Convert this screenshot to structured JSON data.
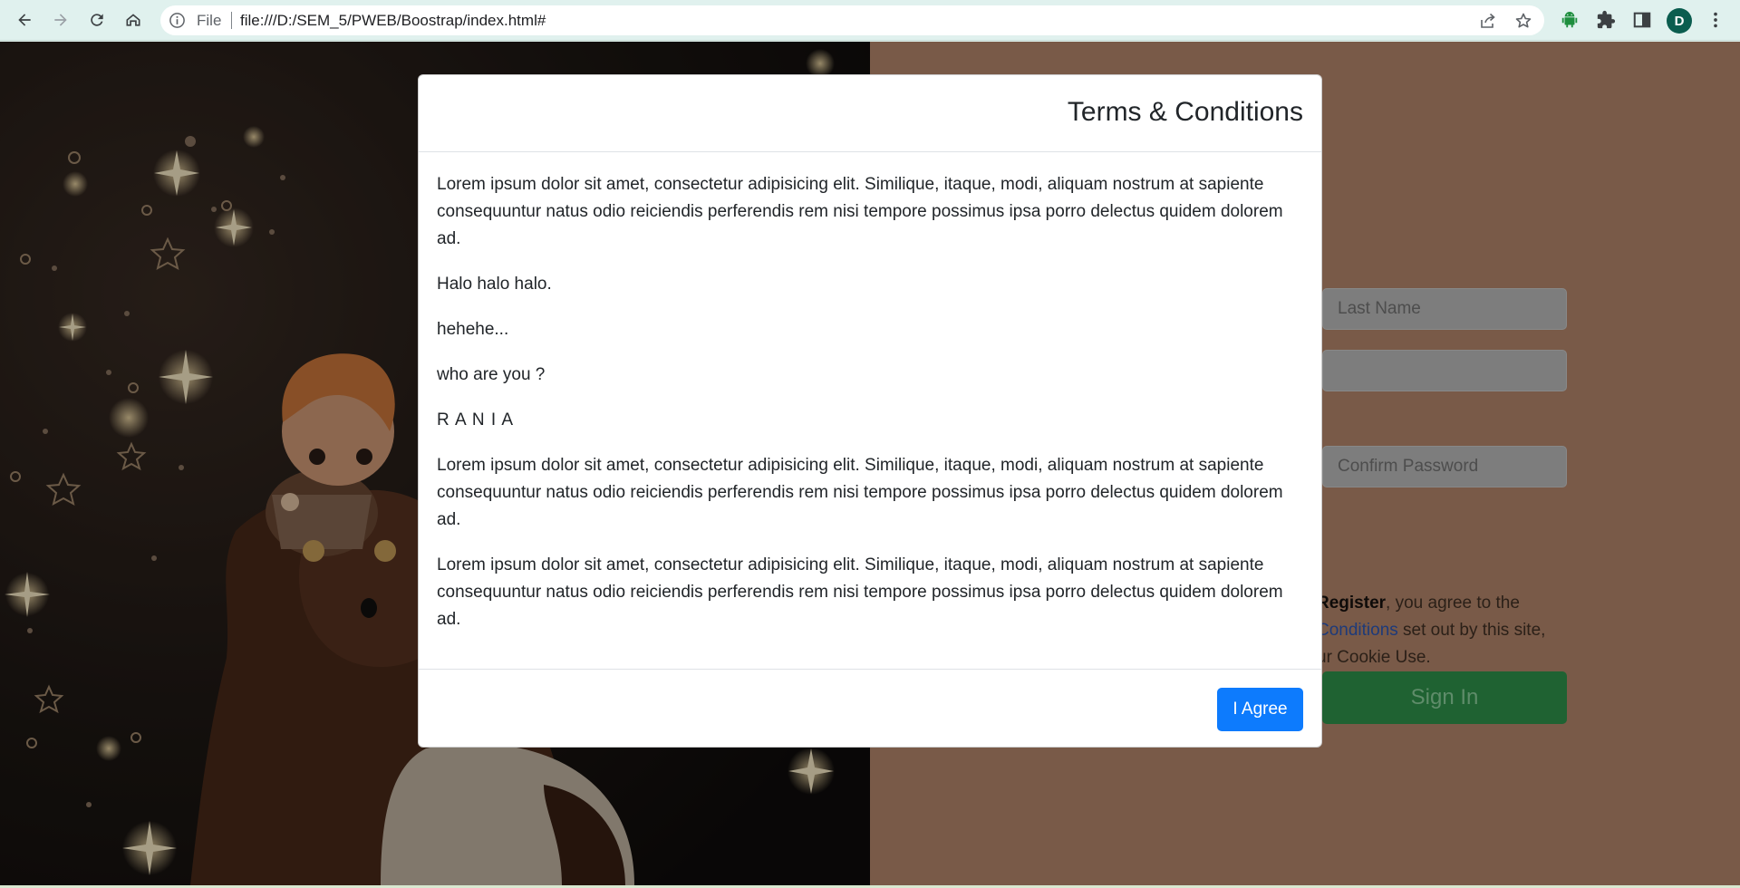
{
  "browser": {
    "scheme_label": "File",
    "url": "file:///D:/SEM_5/PWEB/Boostrap/index.html#",
    "profile_initial": "D"
  },
  "background_form": {
    "last_name_placeholder": "Last Name",
    "confirm_password_placeholder": "Confirm Password",
    "terms_line1_bold": "Register",
    "terms_line1_rest": ", you agree to the",
    "terms_line2_link": "Conditions",
    "terms_line2_rest": " set out by this site,",
    "terms_line3": "ur Cookie Use.",
    "sign_in_label": "Sign In"
  },
  "modal": {
    "title": "Terms & Conditions",
    "paragraphs": [
      "Lorem ipsum dolor sit amet, consectetur adipisicing elit. Similique, itaque, modi, aliquam nostrum at sapiente consequuntur natus odio reiciendis perferendis rem nisi tempore possimus ipsa porro delectus quidem dolorem ad.",
      "Halo halo halo.",
      "hehehe...",
      "who are you ?",
      "R A N I A",
      "Lorem ipsum dolor sit amet, consectetur adipisicing elit. Similique, itaque, modi, aliquam nostrum at sapiente consequuntur natus odio reiciendis perferendis rem nisi tempore possimus ipsa porro delectus quidem dolorem ad.",
      "Lorem ipsum dolor sit amet, consectetur adipisicing elit. Similique, itaque, modi, aliquam nostrum at sapiente consequuntur natus odio reiciendis perferendis rem nisi tempore possimus ipsa porro delectus quidem dolorem ad."
    ],
    "agree_label": "I Agree"
  },
  "colors": {
    "agree_button": "#0d7bfd",
    "sign_in_button": "#1f6232",
    "page_overlay": "#795a48",
    "avatar": "#0b5d4f"
  },
  "icons": [
    "back-arrow-icon",
    "forward-arrow-icon",
    "reload-icon",
    "home-icon",
    "info-icon",
    "share-icon",
    "star-icon",
    "android-extension-icon",
    "puzzle-icon",
    "side-panel-icon",
    "kebab-menu-icon"
  ]
}
